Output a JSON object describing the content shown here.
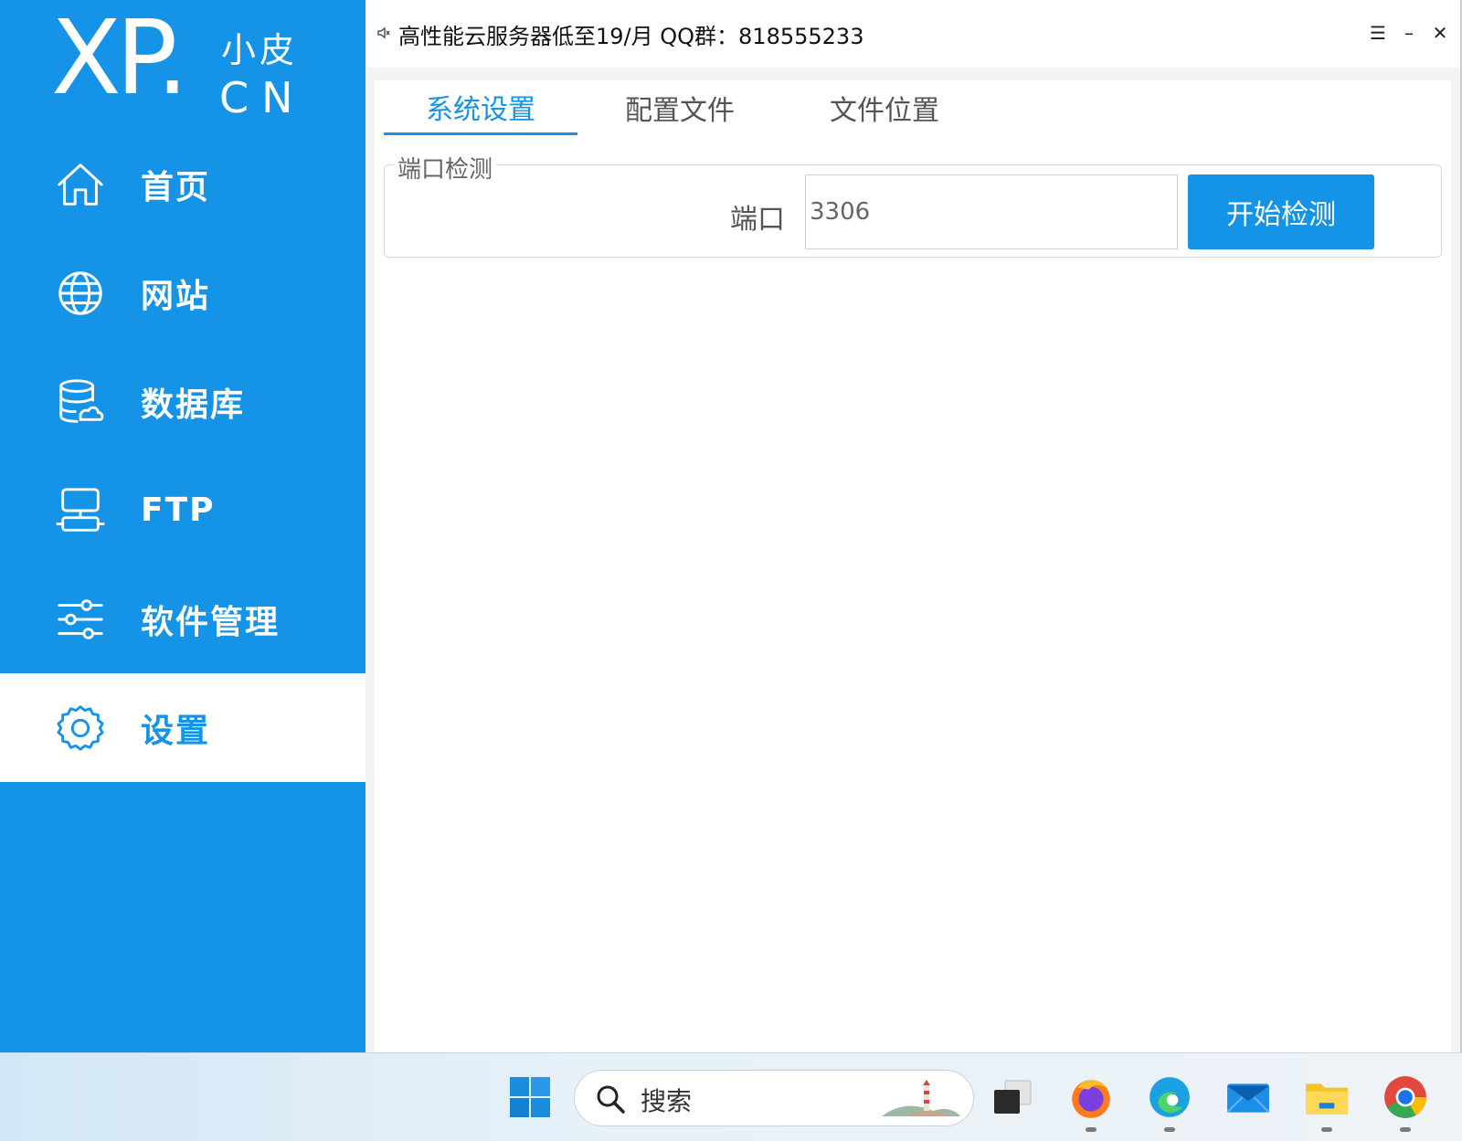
{
  "logo": {
    "brand": "XP.",
    "name": "小皮",
    "domain": "CN"
  },
  "sidebar": {
    "items": [
      {
        "label": "首页",
        "icon": "home-icon"
      },
      {
        "label": "网站",
        "icon": "globe-icon"
      },
      {
        "label": "数据库",
        "icon": "database-icon"
      },
      {
        "label": "FTP",
        "icon": "ftp-icon"
      },
      {
        "label": "软件管理",
        "icon": "sliders-icon"
      },
      {
        "label": "设置",
        "icon": "gear-icon",
        "active": true
      }
    ]
  },
  "titlebar": {
    "announcement": "高性能云服务器低至19/月  QQ群：818555233",
    "menu_glyph": "☰",
    "minimize_glyph": "–",
    "close_glyph": "✕"
  },
  "tabs": [
    {
      "label": "系统设置",
      "active": true
    },
    {
      "label": "配置文件"
    },
    {
      "label": "文件位置"
    }
  ],
  "port_check": {
    "legend": "端口检测",
    "port_label": "端口",
    "port_value": "3306",
    "button_label": "开始检测"
  },
  "taskbar": {
    "search_placeholder": "搜索",
    "apps": [
      "windows-start-icon",
      "task-view-icon",
      "firefox-icon",
      "edge-icon",
      "mail-icon",
      "file-explorer-icon",
      "chrome-icon"
    ]
  },
  "colors": {
    "accent": "#1593e6",
    "sidebar_bg": "#1593e6",
    "panel_bg": "#ffffff"
  }
}
